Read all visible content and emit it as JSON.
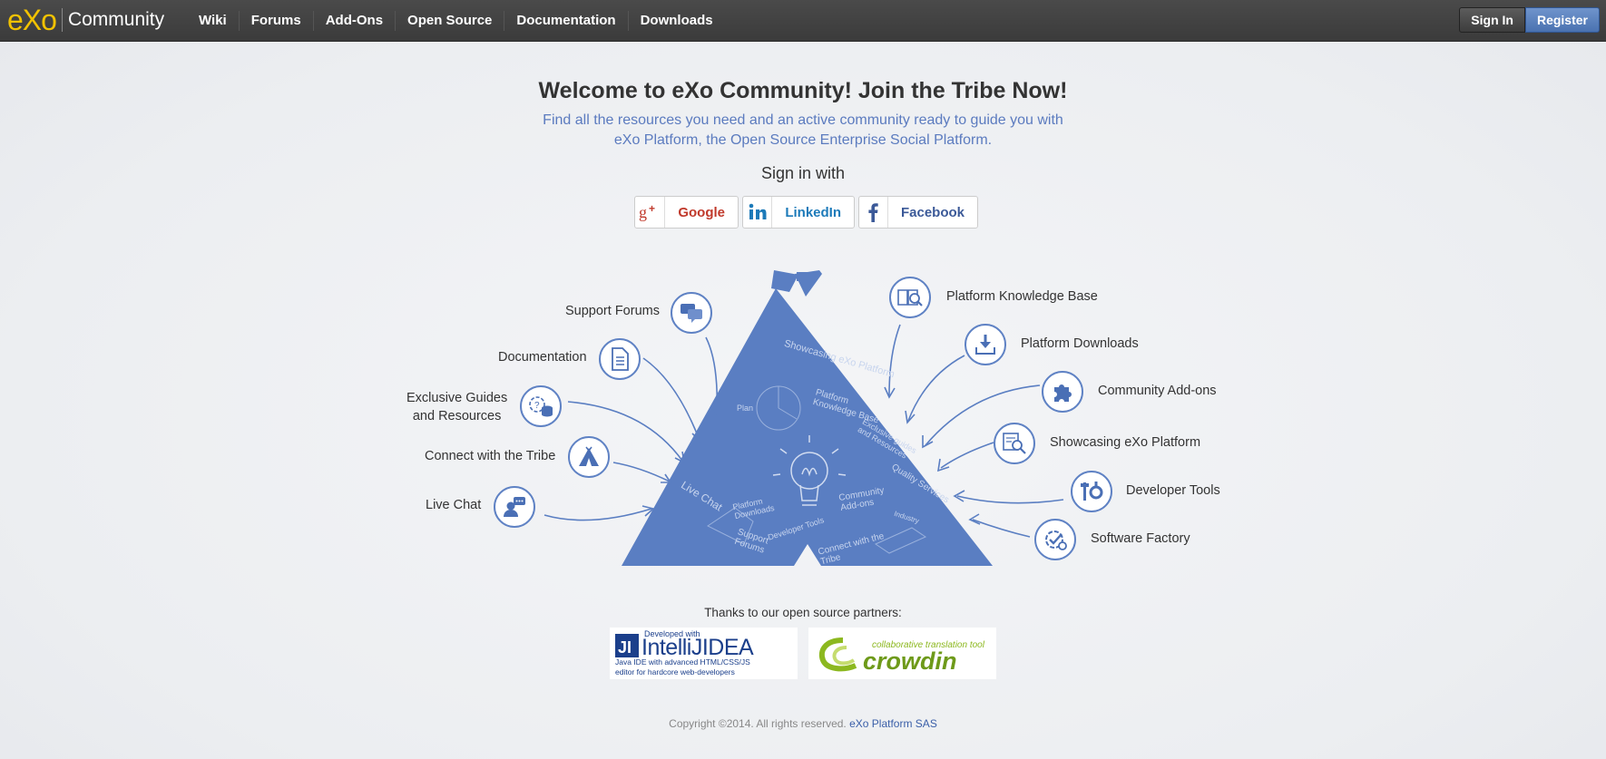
{
  "header": {
    "logo": "eXo",
    "site_name": "Community",
    "nav": [
      "Wiki",
      "Forums",
      "Add-Ons",
      "Open Source",
      "Documentation",
      "Downloads"
    ],
    "signin_label": "Sign In",
    "register_label": "Register"
  },
  "hero": {
    "title": "Welcome to eXo Community! Join the Tribe Now!",
    "subtitle": "Find all the resources you need and an active community ready to guide you with eXo Platform, the Open Source Enterprise Social Platform.",
    "signin_with": "Sign in with",
    "providers": [
      {
        "label": "Google",
        "icon": "google-plus-icon",
        "color": "#c0392b"
      },
      {
        "label": "LinkedIn",
        "icon": "linkedin-icon",
        "color": "#1c7ab9"
      },
      {
        "label": "Facebook",
        "icon": "facebook-icon",
        "color": "#3b5998"
      }
    ]
  },
  "tribe": {
    "left_items": [
      {
        "label": "Support Forums",
        "icon": "chat-bubbles-icon"
      },
      {
        "label": "Documentation",
        "icon": "document-icon"
      },
      {
        "label_line1": "Exclusive Guides",
        "label_line2": "and Resources",
        "icon": "guides-resources-icon"
      },
      {
        "label": "Connect with the Tribe",
        "icon": "teepee-icon"
      },
      {
        "label": "Live Chat",
        "icon": "live-chat-icon"
      }
    ],
    "right_items": [
      {
        "label": "Platform Knowledge Base",
        "icon": "book-search-icon"
      },
      {
        "label": "Platform Downloads",
        "icon": "download-icon"
      },
      {
        "label": "Community Add-ons",
        "icon": "puzzle-icon"
      },
      {
        "label": "Showcasing eXo Platform",
        "icon": "showcase-search-icon"
      },
      {
        "label": "Developer Tools",
        "icon": "tools-icon"
      },
      {
        "label": "Software Factory",
        "icon": "gear-check-icon"
      }
    ],
    "tent_texts": [
      "Showcasing eXo Platform",
      "Platform Knowledge Base",
      "Exclusive guides and Resources",
      "Quality Services",
      "Community Add-ons",
      "Live Chat",
      "Platform Downloads",
      "Developer Tools",
      "Support Forums",
      "Connect with the Tribe",
      "Plan",
      "Industry"
    ],
    "accent_color": "#5a7ec2"
  },
  "partners": {
    "label": "Thanks to our open source partners:",
    "intellij": {
      "line1": "Developed with",
      "name": "IntelliJIDEA",
      "line2": "Java IDE with advanced HTML/CSS/JS",
      "line3": "editor for hardcore web-developers"
    },
    "crowdin": {
      "tagline": "collaborative translation tool",
      "name": "crowdin"
    }
  },
  "footer": {
    "copyright": "Copyright ©2014. All rights reserved.",
    "company": "eXo Platform SAS"
  }
}
